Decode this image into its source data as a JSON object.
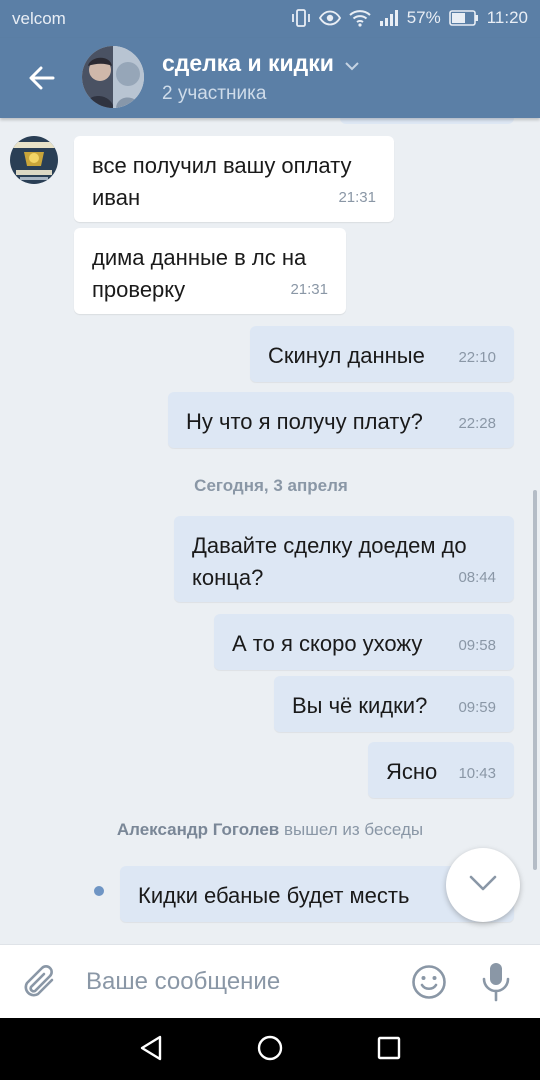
{
  "status_bar": {
    "carrier": "velcom",
    "battery": "57%",
    "time": "11:20"
  },
  "header": {
    "title": "сделка  и кидки",
    "subtitle": "2 участника"
  },
  "messages": [
    {
      "direction": "in",
      "text_lines": [
        "все получил вашу оплату",
        "иван"
      ],
      "time": "21:31"
    },
    {
      "direction": "in",
      "text_lines": [
        "дима данные в лс на",
        "проверку"
      ],
      "time": "21:31"
    },
    {
      "direction": "out",
      "text_lines": [
        "Скинул данные"
      ],
      "time": "22:10"
    },
    {
      "direction": "out",
      "text_lines": [
        "Ну что я получу плату?"
      ],
      "time": "22:28"
    },
    {
      "direction": "out",
      "text_lines": [
        "Давайте сделку доедем до",
        "конца?"
      ],
      "time": "08:44"
    },
    {
      "direction": "out",
      "text_lines": [
        "А то я скоро ухожу"
      ],
      "time": "09:58"
    },
    {
      "direction": "out",
      "text_lines": [
        "Вы чё кидки?"
      ],
      "time": "09:59"
    },
    {
      "direction": "out",
      "text_lines": [
        "Ясно"
      ],
      "time": "10:43"
    },
    {
      "direction": "out",
      "text_lines": [
        "Кидки ебаные будет месть"
      ],
      "time": ""
    }
  ],
  "date_separator": "Сегодня, 3 апреля",
  "service_message": {
    "name": "Александр Гоголев",
    "action": "вышел из беседы"
  },
  "composer": {
    "placeholder": "Ваше сообщение"
  },
  "icons": {
    "back": "arrow-left-icon",
    "attach": "paperclip-icon",
    "emoji": "smiley-icon",
    "mic": "microphone-icon",
    "scroll_down": "chevron-down-icon",
    "nav_back": "triangle-back-icon",
    "nav_home": "circle-home-icon",
    "nav_recents": "square-recents-icon"
  },
  "colors": {
    "header": "#5b7fa6",
    "outgoing_bubble": "#dde7f4",
    "incoming_bubble": "#ffffff",
    "background": "#ebeff3"
  }
}
